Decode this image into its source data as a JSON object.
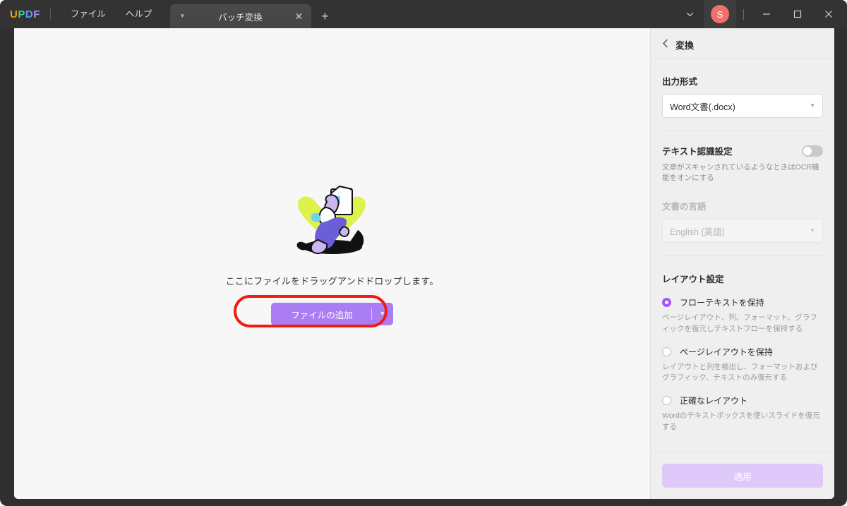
{
  "titlebar": {
    "logo": [
      "U",
      "P",
      "D",
      "F"
    ],
    "menus": [
      "ファイル",
      "ヘルプ"
    ],
    "tab": {
      "title": "バッチ変換",
      "caret_icon": "chevron-down-icon",
      "close_icon": "close-icon"
    },
    "new_tab_icon": "plus-icon",
    "overflow_icon": "chevron-down-icon",
    "avatar_initial": "S",
    "minimize_icon": "minimize-icon",
    "maximize_icon": "maximize-icon",
    "close_icon": "close-icon"
  },
  "canvas": {
    "drop_text": "ここにファイルをドラッグアンドドロップします。",
    "add_button_label": "ファイルの追加",
    "add_button_caret_icon": "chevron-down-icon",
    "highlight_color": "#f01c13",
    "illustration_name": "person-with-document-illustration"
  },
  "panel": {
    "back_icon": "chevron-left-icon",
    "title": "変換",
    "output_format": {
      "label": "出力形式",
      "value": "Word文書(.docx)"
    },
    "ocr": {
      "label": "テキスト認識設定",
      "toggle_state": "off",
      "description": "文章がスキャンされているようなときはOCR機能をオンにする",
      "language_label": "文書の言語",
      "language_value": "English (英語)"
    },
    "layout": {
      "label": "レイアウト設定",
      "options": [
        {
          "label": "フローテキストを保持",
          "description": "ページレイアウト、列、フォーマット、グラフィックを復元しテキストフローを保持する",
          "selected": true
        },
        {
          "label": "ページレイアウトを保持",
          "description": "レイアウトと列を検出し、フォーマットおよびグラフィック、テキストのみ復元する",
          "selected": false
        },
        {
          "label": "正確なレイアウト",
          "description": "Wordのテキストボックスを使いスライドを復元する",
          "selected": false
        }
      ]
    },
    "apply_label": "適用",
    "accent_color": "#a855f7"
  }
}
